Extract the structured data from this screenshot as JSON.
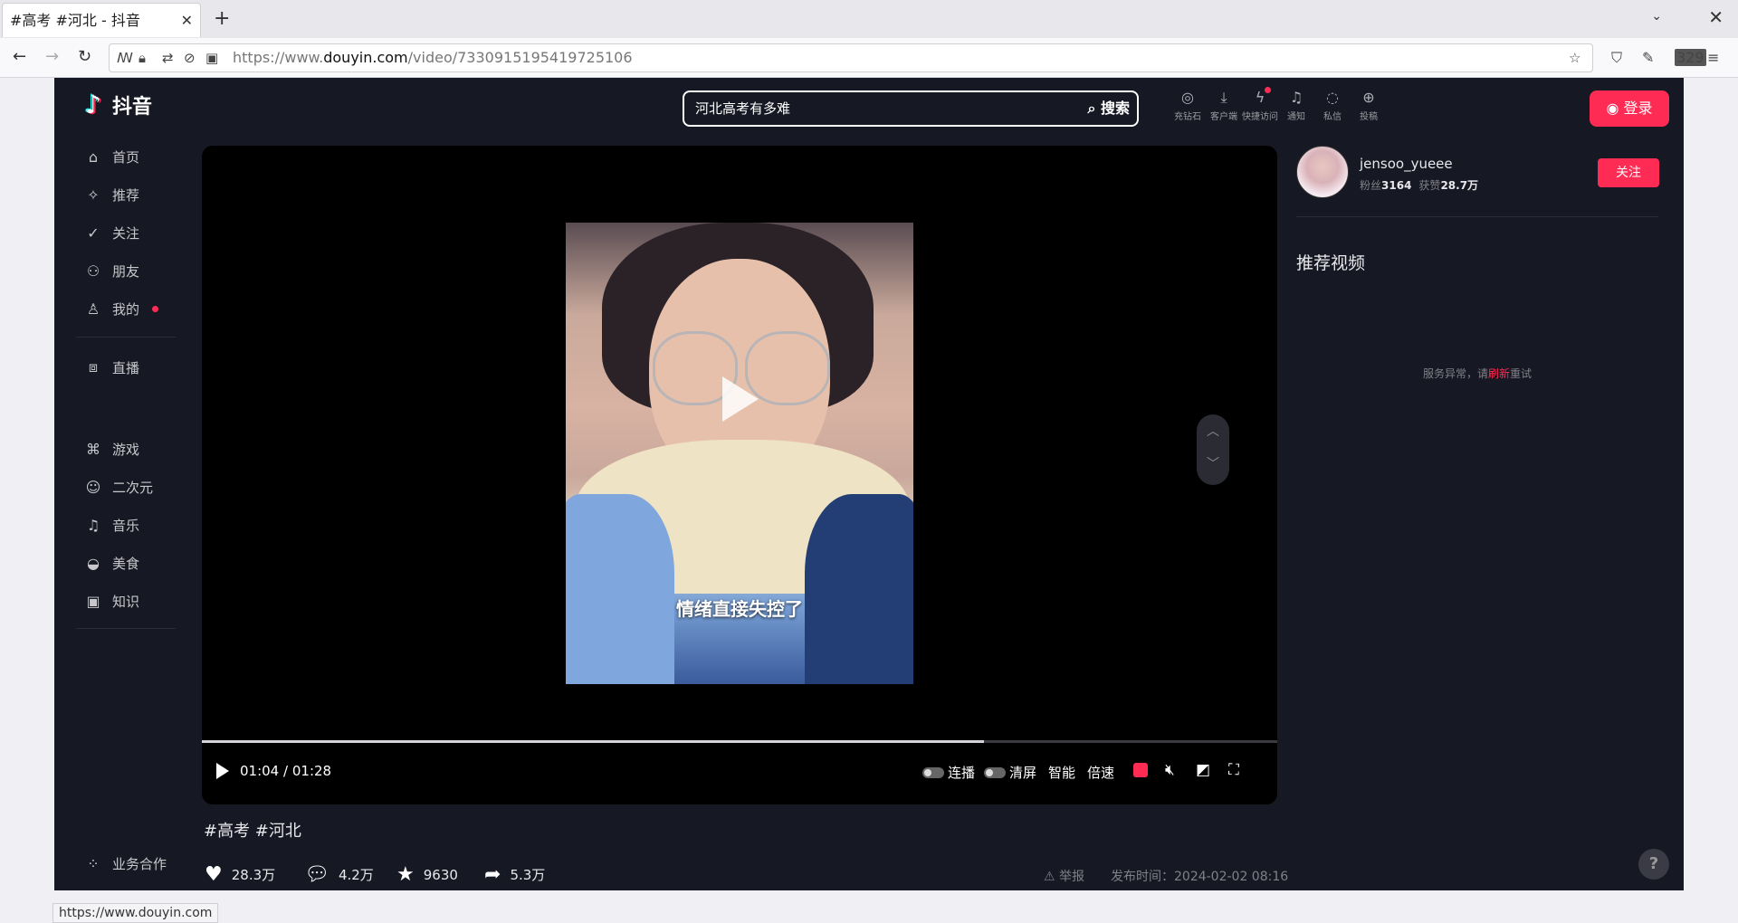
{
  "browser": {
    "tab_title": "#高考 #河北 - 抖音",
    "url_prefix": "https://www.",
    "url_domain": "douyin.com",
    "url_path": "/video/7330915195419725106",
    "ext_badge": "329",
    "status_url": "https://www.douyin.com"
  },
  "header": {
    "logo_text": "抖音",
    "search_value": "河北高考有多难",
    "search_button": "搜索",
    "actions": [
      {
        "label": "充钻石",
        "icon": "diamond-icon"
      },
      {
        "label": "客户端",
        "icon": "download-icon"
      },
      {
        "label": "快捷访问",
        "icon": "bolt-icon"
      },
      {
        "label": "通知",
        "icon": "bell-icon"
      },
      {
        "label": "私信",
        "icon": "chat-icon"
      },
      {
        "label": "投稿",
        "icon": "upload-icon"
      }
    ],
    "login_label": "登录"
  },
  "sidebar": {
    "items": [
      {
        "label": "首页",
        "icon": "home-icon"
      },
      {
        "label": "推荐",
        "icon": "sparkle-icon"
      },
      {
        "label": "关注",
        "icon": "follow-icon"
      },
      {
        "label": "朋友",
        "icon": "friends-icon"
      },
      {
        "label": "我的",
        "icon": "user-icon"
      },
      {
        "label": "直播",
        "icon": "live-icon"
      },
      {
        "label": "游戏",
        "icon": "game-icon"
      },
      {
        "label": "二次元",
        "icon": "anime-icon"
      },
      {
        "label": "音乐",
        "icon": "music-icon"
      },
      {
        "label": "美食",
        "icon": "food-icon"
      },
      {
        "label": "知识",
        "icon": "knowledge-icon"
      }
    ],
    "biz_label": "业务合作"
  },
  "player": {
    "caption": "情绪直接失控了",
    "current_time": "01:04",
    "separator": "/",
    "duration": "01:28",
    "progress": 0.727,
    "autoplay_label": "连播",
    "clear_label": "清屏",
    "smart_label": "智能",
    "speed_label": "倍速"
  },
  "video_info": {
    "tags": "#高考  #河北",
    "likes": "28.3万",
    "comments": "4.2万",
    "favorites": "9630",
    "shares": "5.3万",
    "report_label": "举报",
    "publish_time": "发布时间：2024-02-02 08:16"
  },
  "author": {
    "name": "jensoo_yueee",
    "fans_label": "粉丝",
    "fans": "3164",
    "likes_label": "获赞",
    "likes": "28.7万",
    "follow_label": "关注"
  },
  "recommend": {
    "title": "推荐视频",
    "error_prefix": "服务异常，请",
    "error_link": "刷新",
    "error_suffix": "重试"
  },
  "colors": {
    "accent": "#fe2c55",
    "page_bg": "#161823"
  }
}
